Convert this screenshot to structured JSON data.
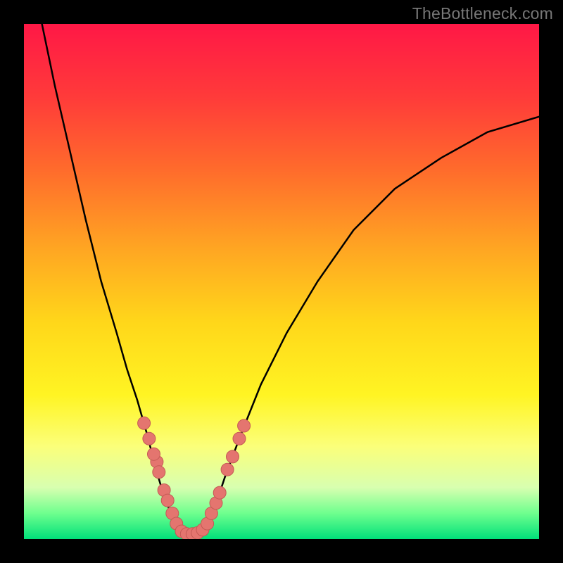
{
  "watermark": "TheBottleneck.com",
  "colors": {
    "frame": "#000000",
    "curve": "#000000",
    "marker_fill": "#e4756f",
    "marker_stroke": "#c45a55"
  },
  "chart_data": {
    "type": "line",
    "title": "",
    "xlabel": "",
    "ylabel": "",
    "xlim": [
      0,
      100
    ],
    "ylim": [
      0,
      100
    ],
    "grid": false,
    "legend": false,
    "series": [
      {
        "name": "bottleneck-curve-left",
        "x": [
          3.5,
          6,
          9,
          12,
          15,
          18,
          20,
          22,
          24,
          25.5,
          27,
          28.5,
          29.8
        ],
        "y": [
          100,
          88,
          75,
          62,
          50,
          40,
          33,
          27,
          20,
          14,
          9,
          5,
          2
        ]
      },
      {
        "name": "bottleneck-curve-floor",
        "x": [
          29.8,
          31,
          32.5,
          34,
          35.5
        ],
        "y": [
          2,
          1,
          0.6,
          1,
          2
        ]
      },
      {
        "name": "bottleneck-curve-right",
        "x": [
          35.5,
          37,
          39,
          42,
          46,
          51,
          57,
          64,
          72,
          81,
          90,
          100
        ],
        "y": [
          2,
          6,
          12,
          20,
          30,
          40,
          50,
          60,
          68,
          74,
          79,
          82
        ]
      }
    ],
    "markers": {
      "name": "data-points",
      "x": [
        23.3,
        24.3,
        25.8,
        25.2,
        26.2,
        27.2,
        27.9,
        28.8,
        29.6,
        30.6,
        31.6,
        32.7,
        33.7,
        34.7,
        35.6,
        36.4,
        37.3,
        38.0,
        39.5,
        40.5,
        41.8,
        42.7
      ],
      "y": [
        22.5,
        19.5,
        15.0,
        16.5,
        13.0,
        9.5,
        7.5,
        5.0,
        3.0,
        1.5,
        1.0,
        1.0,
        1.2,
        1.8,
        3.0,
        5.0,
        7.0,
        9.0,
        13.5,
        16.0,
        19.5,
        22.0
      ]
    }
  }
}
